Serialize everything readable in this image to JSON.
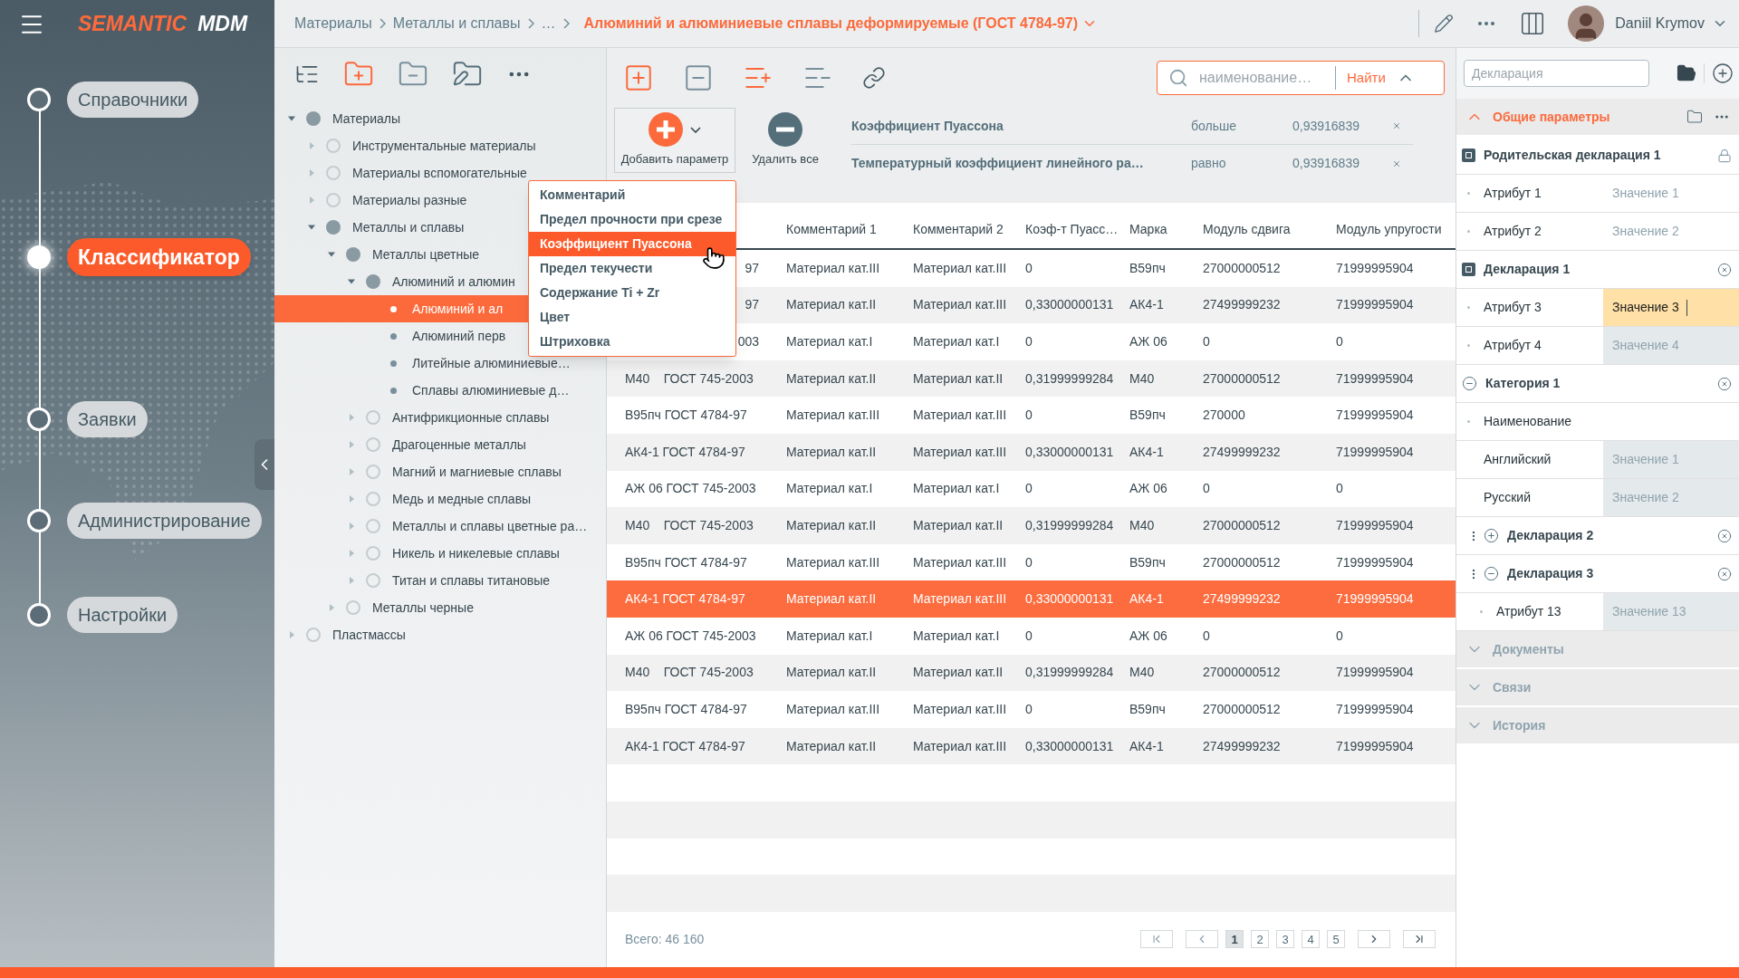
{
  "app": {
    "logo_primary": "SEMANTIC",
    "logo_secondary": "MDM"
  },
  "nav": [
    {
      "label": "Справочники",
      "selected": false
    },
    {
      "label": "Классификатор",
      "selected": true
    },
    {
      "label": "Заявки",
      "selected": false
    },
    {
      "label": "Администрирование",
      "selected": false
    },
    {
      "label": "Настройки",
      "selected": false
    }
  ],
  "breadcrumbs": [
    "Материалы",
    "Металлы и сплавы",
    "…"
  ],
  "page_title": "Алюминий и алюминиевые сплавы деформируемые (ГОСТ 4784-97)",
  "user": {
    "name": "Daniil Krymov"
  },
  "tree": [
    {
      "label": "Материалы",
      "kind": "folder",
      "expanded": true,
      "selected": false,
      "children": [
        {
          "label": "Инструментальные материалы",
          "kind": "folder",
          "expanded": false,
          "selected": false
        },
        {
          "label": "Материалы вспомогательные",
          "kind": "folder",
          "expanded": false,
          "selected": false
        },
        {
          "label": "Материалы разные",
          "kind": "folder",
          "expanded": false,
          "selected": false
        },
        {
          "label": "Металлы и сплавы",
          "kind": "folder",
          "expanded": true,
          "selected": false,
          "children": [
            {
              "label": "Металлы цветные",
              "kind": "folder",
              "expanded": true,
              "selected": false,
              "children": [
                {
                  "label": "Алюминий и алюмин",
                  "kind": "folder",
                  "expanded": true,
                  "selected": false,
                  "children": [
                    {
                      "label": "Алюминий и ал",
                      "kind": "leaf",
                      "selected": true
                    },
                    {
                      "label": "Алюминий перв",
                      "kind": "leaf",
                      "selected": false
                    },
                    {
                      "label": "Литейные алюминиевые…",
                      "kind": "leaf",
                      "selected": false
                    },
                    {
                      "label": "Сплавы алюминиевые д…",
                      "kind": "leaf",
                      "selected": false
                    }
                  ]
                },
                {
                  "label": "Антифрикционные сплавы",
                  "kind": "folder",
                  "expanded": false,
                  "selected": false
                },
                {
                  "label": "Драгоценные металлы",
                  "kind": "folder",
                  "expanded": false,
                  "selected": false
                },
                {
                  "label": "Магний и магниевые сплавы",
                  "kind": "folder",
                  "expanded": false,
                  "selected": false
                },
                {
                  "label": "Медь и медные сплавы",
                  "kind": "folder",
                  "expanded": false,
                  "selected": false
                },
                {
                  "label": "Металлы и сплавы цветные ра…",
                  "kind": "folder",
                  "expanded": false,
                  "selected": false
                },
                {
                  "label": "Никель и никелевые сплавы",
                  "kind": "folder",
                  "expanded": false,
                  "selected": false
                },
                {
                  "label": "Титан и сплавы титановые",
                  "kind": "folder",
                  "expanded": false,
                  "selected": false
                }
              ]
            },
            {
              "label": "Металлы черные",
              "kind": "folder",
              "expanded": false,
              "selected": false
            }
          ]
        }
      ]
    },
    {
      "label": "Пластмассы",
      "kind": "folder",
      "expanded": false,
      "selected": false
    }
  ],
  "param_menu": [
    {
      "label": "Комментарий",
      "selected": false
    },
    {
      "label": "Предел прочности при срезе",
      "selected": false
    },
    {
      "label": "Коэффициент Пуассона",
      "selected": true
    },
    {
      "label": "Предел текучести",
      "selected": false
    },
    {
      "label": "Содержание Ti + Zr",
      "selected": false
    },
    {
      "label": "Цвет",
      "selected": false
    },
    {
      "label": "Штриховка",
      "selected": false
    }
  ],
  "search": {
    "placeholder": "наименование…",
    "button": "Найти"
  },
  "add_param": "Добавить параметр",
  "delete_all": "Удалить все",
  "filters": [
    {
      "name": "Коэффициент Пуассона",
      "op": "больше",
      "value": "0,93916839"
    },
    {
      "name": "Температурный коэффициент линейного ра…",
      "op": "равно",
      "value": "0,93916839"
    }
  ],
  "table": {
    "columns": [
      "",
      "Комментарий 1",
      "Комментарий 2",
      "Коэф-т Пуасс…",
      "Марка",
      "Модуль сдвига",
      "Модуль упругости"
    ],
    "rows": [
      {
        "cut": true,
        "selected": false,
        "cells": [
          "97",
          "Материал кат.III",
          "Материал кат.III",
          "0",
          "В59пч",
          "27000000512",
          "71999995904"
        ]
      },
      {
        "cut": true,
        "selected": false,
        "cells": [
          "97",
          "Материал кат.II",
          "Материал кат.III",
          "0,33000000131",
          "АК4-1",
          "27499999232",
          "71999995904"
        ]
      },
      {
        "cut": true,
        "selected": false,
        "cells": [
          "003",
          "Материал кат.I",
          "Материал кат.I",
          "0",
          "АЖ 06",
          "0",
          "0"
        ]
      },
      {
        "cut": false,
        "selected": false,
        "cells": [
          "М40    ГОСТ 745-2003",
          "Материал кат.II",
          "Материал кат.II",
          "0,31999999284",
          "М40",
          "27000000512",
          "71999995904"
        ]
      },
      {
        "cut": false,
        "selected": false,
        "cells": [
          "В95пч ГОСТ 4784-97",
          "Материал кат.III",
          "Материал кат.III",
          "0",
          "В59пч",
          "270000",
          "71999995904"
        ]
      },
      {
        "cut": false,
        "selected": false,
        "cells": [
          "АК4-1 ГОСТ 4784-97",
          "Материал кат.II",
          "Материал кат.III",
          "0,33000000131",
          "АК4-1",
          "27499999232",
          "71999995904"
        ]
      },
      {
        "cut": false,
        "selected": false,
        "cells": [
          "АЖ 06 ГОСТ 745-2003",
          "Материал кат.I",
          "Материал кат.I",
          "0",
          "АЖ 06",
          "0",
          "0"
        ]
      },
      {
        "cut": false,
        "selected": false,
        "cells": [
          "М40    ГОСТ 745-2003",
          "Материал кат.II",
          "Материал кат.II",
          "0,31999999284",
          "М40",
          "27000000512",
          "71999995904"
        ]
      },
      {
        "cut": false,
        "selected": false,
        "cells": [
          "В95пч ГОСТ 4784-97",
          "Материал кат.III",
          "Материал кат.III",
          "0",
          "В59пч",
          "27000000512",
          "71999995904"
        ]
      },
      {
        "cut": false,
        "selected": true,
        "cells": [
          "АК4-1 ГОСТ 4784-97",
          "Материал кат.II",
          "Материал кат.III",
          "0,33000000131",
          "АК4-1",
          "27499999232",
          "71999995904"
        ]
      },
      {
        "cut": false,
        "selected": false,
        "cells": [
          "АЖ 06 ГОСТ 745-2003",
          "Материал кат.I",
          "Материал кат.I",
          "0",
          "АЖ 06",
          "0",
          "0"
        ]
      },
      {
        "cut": false,
        "selected": false,
        "cells": [
          "М40    ГОСТ 745-2003",
          "Материал кат.II",
          "Материал кат.II",
          "0,31999999284",
          "М40",
          "27000000512",
          "71999995904"
        ]
      },
      {
        "cut": false,
        "selected": false,
        "cells": [
          "В95пч ГОСТ 4784-97",
          "Материал кат.III",
          "Материал кат.III",
          "0",
          "В59пч",
          "27000000512",
          "71999995904"
        ]
      },
      {
        "cut": false,
        "selected": false,
        "cells": [
          "АК4-1 ГОСТ 4784-97",
          "Материал кат.II",
          "Материал кат.III",
          "0,33000000131",
          "АК4-1",
          "27499999232",
          "71999995904"
        ]
      }
    ],
    "total": "Всего: 46 160",
    "pages": [
      {
        "label": "1",
        "selected": true
      },
      {
        "label": "2",
        "selected": false
      },
      {
        "label": "3",
        "selected": false
      },
      {
        "label": "4",
        "selected": false
      },
      {
        "label": "5",
        "selected": false
      }
    ]
  },
  "panel": {
    "search_placeholder": "Декларация",
    "sections": [
      {
        "title": "Общие параметры",
        "expanded": true,
        "groups": [
          {
            "kind": "declaration",
            "title": "Родительская декларация 1",
            "locked": true,
            "rows": [
              {
                "label": "Атрибут 1",
                "value": "Значение 1",
                "editing": false
              },
              {
                "label": "Атрибут 2",
                "value": "Значение 2",
                "editing": false
              }
            ]
          },
          {
            "kind": "declaration",
            "title": "Декларация 1",
            "locked": false,
            "rows": [
              {
                "label": "Атрибут 3",
                "value": "Значение 3",
                "editing": true
              },
              {
                "label": "Атрибут 4",
                "value": "Значение 4",
                "editing": false
              }
            ]
          },
          {
            "kind": "category",
            "title": "Категория 1",
            "expanded": true,
            "rows": [
              {
                "label": "Наименование"
              },
              {
                "label": "Английский",
                "value": "Значение 1",
                "editing": false
              },
              {
                "label": "Русский",
                "value": "Значение 2",
                "editing": false
              }
            ]
          },
          {
            "kind": "subgroup",
            "title": "Декларация 2",
            "expanded": false
          },
          {
            "kind": "subgroup",
            "title": "Декларация 3",
            "expanded": true,
            "rows": [
              {
                "label": "Атрибут 13",
                "value": "Значение 13",
                "editing": false
              }
            ]
          }
        ]
      },
      {
        "title": "Документы",
        "expanded": false
      },
      {
        "title": "Связи",
        "expanded": false
      },
      {
        "title": "История",
        "expanded": false
      }
    ]
  }
}
